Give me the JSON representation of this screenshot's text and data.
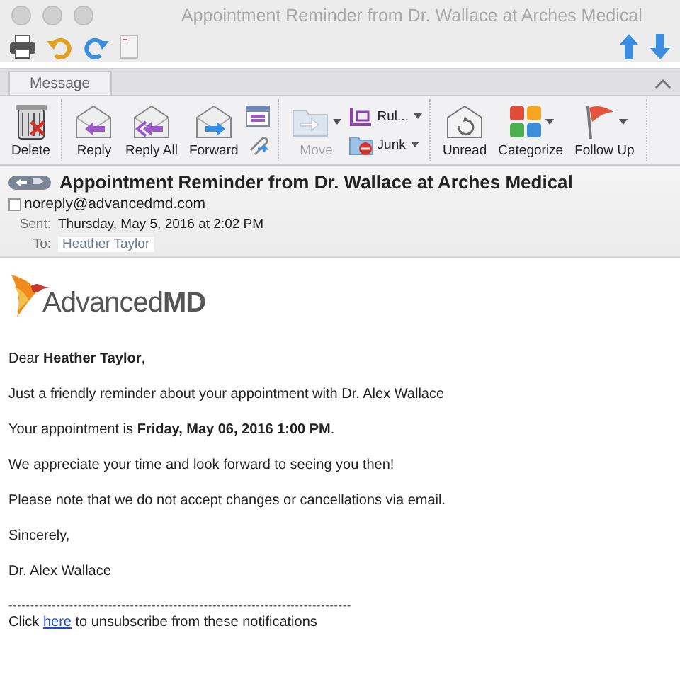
{
  "window": {
    "title": "Appointment Reminder from Dr. Wallace at Arches Medical"
  },
  "tabs": [
    {
      "label": "Message",
      "selected": true
    }
  ],
  "ribbon": [
    [
      {
        "kind": "large",
        "label": "Delete",
        "disabled": false,
        "dropdown": false
      }
    ],
    [
      {
        "kind": "large",
        "label": "Reply",
        "disabled": false,
        "dropdown": false
      },
      {
        "kind": "large",
        "label": "Reply All",
        "disabled": false,
        "dropdown": false
      },
      {
        "kind": "large",
        "label": "Forward",
        "disabled": false,
        "dropdown": false
      },
      {
        "kind": "stack"
      }
    ],
    [
      {
        "kind": "large",
        "label": "Move",
        "disabled": true,
        "dropdown": true
      },
      {
        "kind": "small",
        "items": [
          {
            "label": "Rul...",
            "dropdown": true
          },
          {
            "label": "Junk",
            "dropdown": true
          }
        ]
      }
    ],
    [
      {
        "kind": "large",
        "label": "Unread",
        "disabled": false,
        "dropdown": false
      },
      {
        "kind": "large",
        "label": "Categorize",
        "disabled": false,
        "dropdown": true
      },
      {
        "kind": "large",
        "label": "Follow Up",
        "disabled": false,
        "dropdown": true
      }
    ]
  ],
  "header": {
    "subject": "Appointment Reminder from Dr. Wallace at Arches Medical",
    "from": "noreply@advancedmd.com",
    "sent_label": "Sent:",
    "sent": "Thursday, May 5, 2016 at 2:02 PM",
    "to_label": "To:",
    "to": "Heather Taylor"
  },
  "body": {
    "logo": "Advanced**MD**",
    "paragraphs": [
      "Dear **Heather Taylor**,",
      "Just a friendly reminder about your appointment with Dr. Alex Wallace",
      "Your appointment is **Friday, May 06, 2016 1:00 PM**.",
      "We appreciate your time and look forward to seeing you then!",
      "Please note that we do not accept changes or cancellations via email.",
      "Sincerely,",
      "Dr. Alex Wallace"
    ],
    "rule": "-------------------------------------------------------------------------------",
    "footer_before": "Click",
    "footer_link": "here",
    "footer_after": "to unsubscribe from these notifications"
  }
}
